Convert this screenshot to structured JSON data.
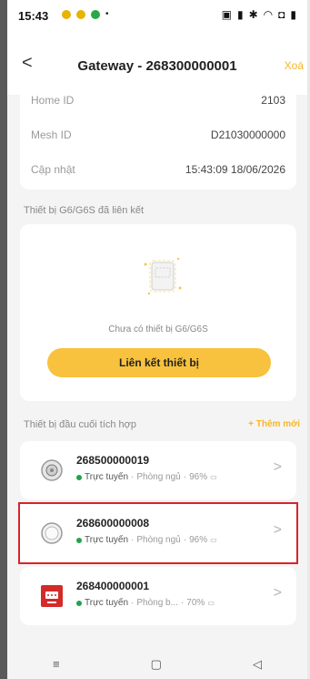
{
  "status_bar": {
    "time": "15:43"
  },
  "header": {
    "title": "Gateway - 268300000001",
    "delete_label": "Xoá"
  },
  "info": [
    {
      "label": "Home ID",
      "value": "2103"
    },
    {
      "label": "Mesh ID",
      "value": "D21030000000"
    },
    {
      "label": "Cập nhật",
      "value": "15:43:09 18/06/2026"
    }
  ],
  "linked_section": {
    "title": "Thiết bị G6/G6S đã liên kết",
    "empty_text": "Chưa có thiết bị G6/G6S",
    "button_label": "Liên kết thiết bị"
  },
  "devices_section": {
    "title": "Thiết bị đầu cuối tích hợp",
    "add_label": "+ Thêm mới",
    "devices": [
      {
        "id": "268500000019",
        "status": "Trực tuyến",
        "room": "Phòng ngủ",
        "battery": "96%"
      },
      {
        "id": "268600000008",
        "status": "Trực tuyến",
        "room": "Phòng ngủ",
        "battery": "96%"
      },
      {
        "id": "268400000001",
        "status": "Trực tuyến",
        "room": "Phòng b...",
        "battery": "70%"
      }
    ]
  },
  "nav": {
    "menu": "≡",
    "home": "▢",
    "back": "◁"
  },
  "colors": {
    "accent": "#f8c23e",
    "selected_border": "#d8232a",
    "online": "#21a34a"
  }
}
